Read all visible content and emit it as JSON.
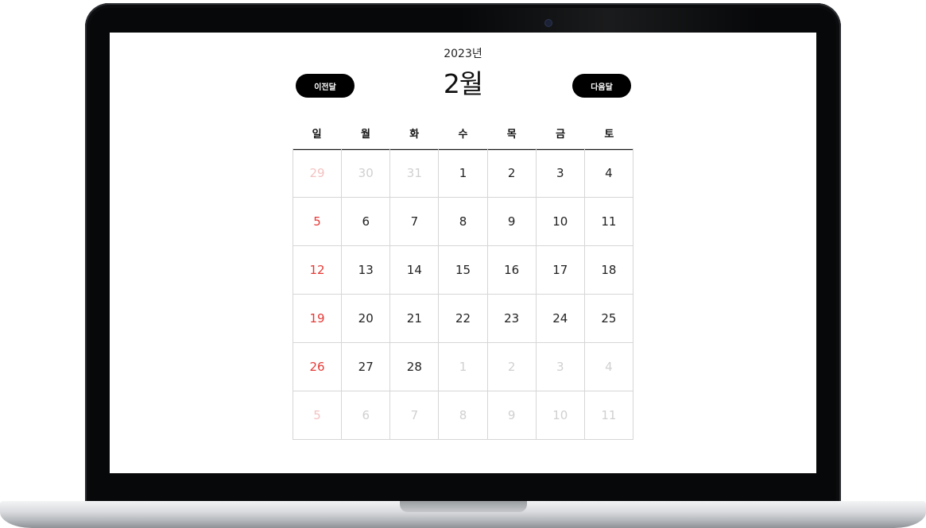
{
  "calendar": {
    "year_label": "2023년",
    "month_label": "2월",
    "prev_label": "이전달",
    "next_label": "다음달",
    "weekdays": [
      "일",
      "월",
      "화",
      "수",
      "목",
      "금",
      "토"
    ],
    "weeks": [
      [
        {
          "d": "29",
          "other": true
        },
        {
          "d": "30",
          "other": true
        },
        {
          "d": "31",
          "other": true
        },
        {
          "d": "1"
        },
        {
          "d": "2"
        },
        {
          "d": "3"
        },
        {
          "d": "4"
        }
      ],
      [
        {
          "d": "5"
        },
        {
          "d": "6"
        },
        {
          "d": "7"
        },
        {
          "d": "8"
        },
        {
          "d": "9"
        },
        {
          "d": "10"
        },
        {
          "d": "11"
        }
      ],
      [
        {
          "d": "12"
        },
        {
          "d": "13"
        },
        {
          "d": "14"
        },
        {
          "d": "15"
        },
        {
          "d": "16"
        },
        {
          "d": "17"
        },
        {
          "d": "18"
        }
      ],
      [
        {
          "d": "19"
        },
        {
          "d": "20"
        },
        {
          "d": "21"
        },
        {
          "d": "22"
        },
        {
          "d": "23"
        },
        {
          "d": "24"
        },
        {
          "d": "25"
        }
      ],
      [
        {
          "d": "26"
        },
        {
          "d": "27"
        },
        {
          "d": "28"
        },
        {
          "d": "1",
          "other": true
        },
        {
          "d": "2",
          "other": true
        },
        {
          "d": "3",
          "other": true
        },
        {
          "d": "4",
          "other": true
        }
      ],
      [
        {
          "d": "5",
          "other": true
        },
        {
          "d": "6",
          "other": true
        },
        {
          "d": "7",
          "other": true
        },
        {
          "d": "8",
          "other": true
        },
        {
          "d": "9",
          "other": true
        },
        {
          "d": "10",
          "other": true
        },
        {
          "d": "11",
          "other": true
        }
      ]
    ]
  },
  "colors": {
    "sunday": "#e53935",
    "button_bg": "#000000",
    "other_month": "#d0d0d0"
  }
}
